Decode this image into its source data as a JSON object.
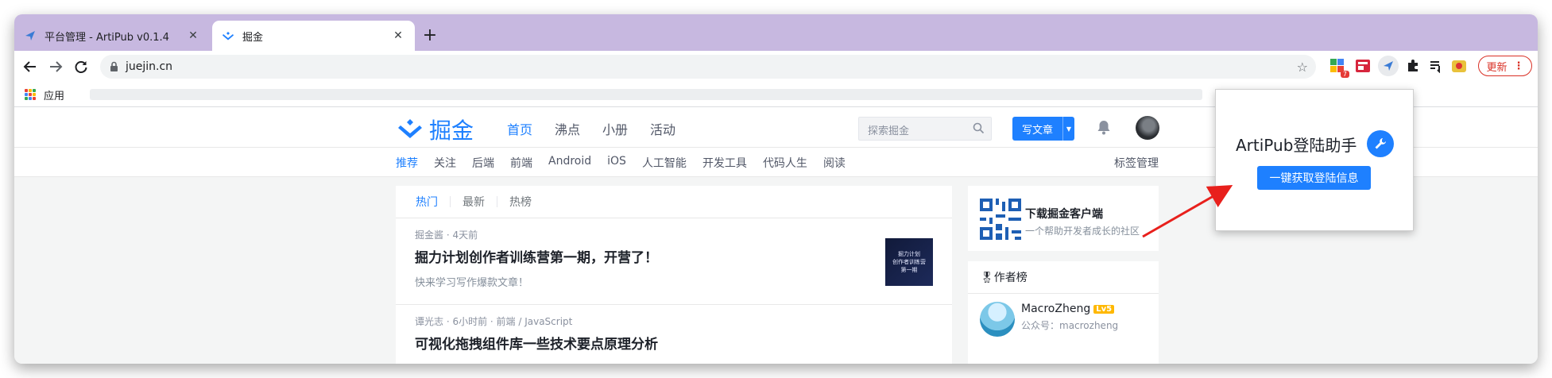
{
  "browser": {
    "tabs": [
      {
        "title": "平台管理 - ArtiPub v0.1.4",
        "active": false
      },
      {
        "title": "掘金",
        "active": true
      }
    ],
    "new_tab": "+",
    "url": "juejin.cn",
    "ext_badge": "7",
    "update_label": "更新",
    "bookmarks_label": "应用"
  },
  "site": {
    "logo_text": "掘金",
    "nav": [
      "首页",
      "沸点",
      "小册",
      "活动"
    ],
    "search_placeholder": "探索掘金",
    "write_label": "写文章",
    "categories": [
      "推荐",
      "关注",
      "后端",
      "前端",
      "Android",
      "iOS",
      "人工智能",
      "开发工具",
      "代码人生",
      "阅读"
    ],
    "tag_manage": "标签管理"
  },
  "feed": {
    "tabs": [
      "热门",
      "最新",
      "热榜"
    ],
    "entries": [
      {
        "meta": "掘金酱 · 4天前",
        "title": "掘力计划创作者训练营第一期，开营了！",
        "desc": "快来学习写作爆款文章！",
        "thumb_line1": "掘力计划",
        "thumb_line2": "创作者训练营",
        "thumb_line3": "第一期"
      },
      {
        "meta": "谭光志 · 6小时前 · 前端 / JavaScript",
        "title": "可视化拖拽组件库一些技术要点原理分析",
        "desc": ""
      }
    ]
  },
  "sidebar": {
    "download_title": "下载掘金客户端",
    "download_sub": "一个帮助开发者成长的社区",
    "authors_title": "🎖作者榜",
    "author_name": "MacroZheng",
    "author_level": "Lv5",
    "author_sub": "公众号：macrozheng"
  },
  "popup": {
    "title": "ArtiPub登陆助手",
    "button": "一键获取登陆信息"
  },
  "colors": {
    "accent": "#1e80ff",
    "tabstrip": "#c7b8e0",
    "arrow": "#e8201c"
  }
}
